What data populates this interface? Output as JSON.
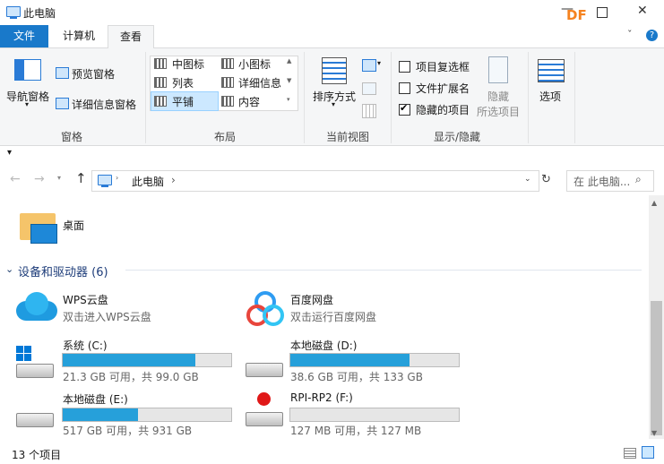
{
  "window": {
    "title": "此电脑"
  },
  "brand": {
    "text": "DF",
    "color": "#f5821f"
  },
  "tabs": {
    "file": "文件",
    "computer": "计算机",
    "view": "查看"
  },
  "ribbon": {
    "panes": {
      "nav_pane": "导航窗格",
      "preview_pane": "预览窗格",
      "details_pane": "详细信息窗格",
      "group": "窗格"
    },
    "layout": {
      "medium_icons": "中图标",
      "small_icons": "小图标",
      "list": "列表",
      "details": "详细信息",
      "tiles": "平铺",
      "content": "内容",
      "group": "布局"
    },
    "current_view": {
      "sort_by": "排序方式",
      "group": "当前视图"
    },
    "show_hide": {
      "item_checkboxes": "项目复选框",
      "file_extensions": "文件扩展名",
      "hidden_items": "隐藏的项目",
      "hide_selected_line1": "隐藏",
      "hide_selected_line2": "所选项目",
      "options": "选项",
      "group": "显示/隐藏"
    }
  },
  "address": {
    "location": "此电脑",
    "search_placeholder": "在 此电脑..."
  },
  "desktop": {
    "label": "桌面"
  },
  "section": {
    "title": "设备和驱动器 (6)"
  },
  "cloud": [
    {
      "name": "WPS云盘",
      "desc": "双击进入WPS云盘"
    },
    {
      "name": "百度网盘",
      "desc": "双击运行百度网盘"
    }
  ],
  "drives": [
    {
      "name": "系统 (C:)",
      "info": "21.3 GB 可用，共 99.0 GB",
      "used_fraction": 0.785
    },
    {
      "name": "本地磁盘 (D:)",
      "info": "38.6 GB 可用，共 133 GB",
      "used_fraction": 0.71
    },
    {
      "name": "本地磁盘 (E:)",
      "info": "517 GB 可用，共 931 GB",
      "used_fraction": 0.445
    },
    {
      "name": "RPI-RP2 (F:)",
      "info": "127 MB 可用，共 127 MB",
      "used_fraction": 0.0
    }
  ],
  "status": {
    "count": "13 个项目"
  }
}
